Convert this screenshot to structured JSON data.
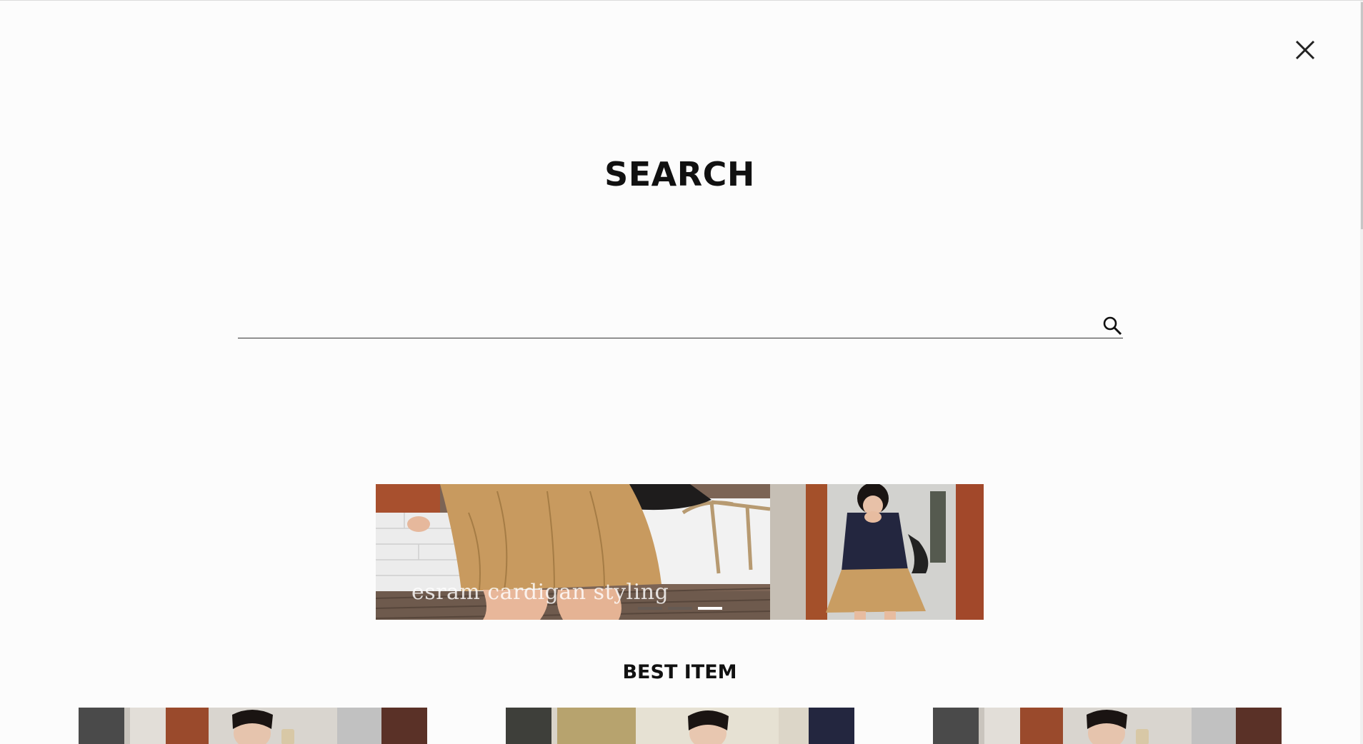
{
  "header": {
    "close_icon": "close-icon"
  },
  "search": {
    "title": "SEARCH",
    "placeholder": "",
    "value": "",
    "submit_icon": "search-icon"
  },
  "banner": {
    "caption": "esram cardigan styling",
    "slides_total": 3,
    "active_slide": 3
  },
  "best_items": {
    "title": "BEST ITEM",
    "count_visible": 3
  },
  "colors": {
    "background": "#fcfcfc",
    "text": "#111111",
    "skirt": "#c9a063",
    "cardigan": "#23263f"
  }
}
